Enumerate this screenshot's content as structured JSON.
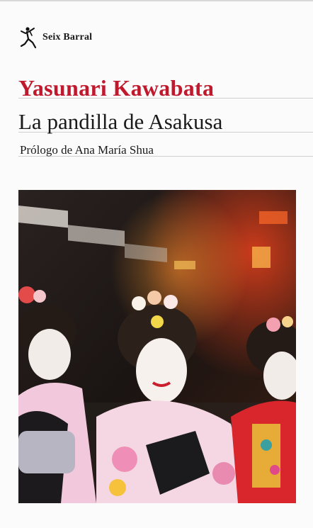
{
  "cover": {
    "publisher": {
      "name": "Seix Barral",
      "logo_icon": "seix-barral-figure-logo"
    },
    "author": "Yasunari Kawabata",
    "title": "La pandilla de Asakusa",
    "subtitle": "Prólogo de Ana María Shua",
    "colors": {
      "author": "#c0182c",
      "text": "#1a1a1a",
      "background": "#fbfbfb"
    },
    "photo": {
      "subject": "geishas-at-night-photo"
    }
  }
}
